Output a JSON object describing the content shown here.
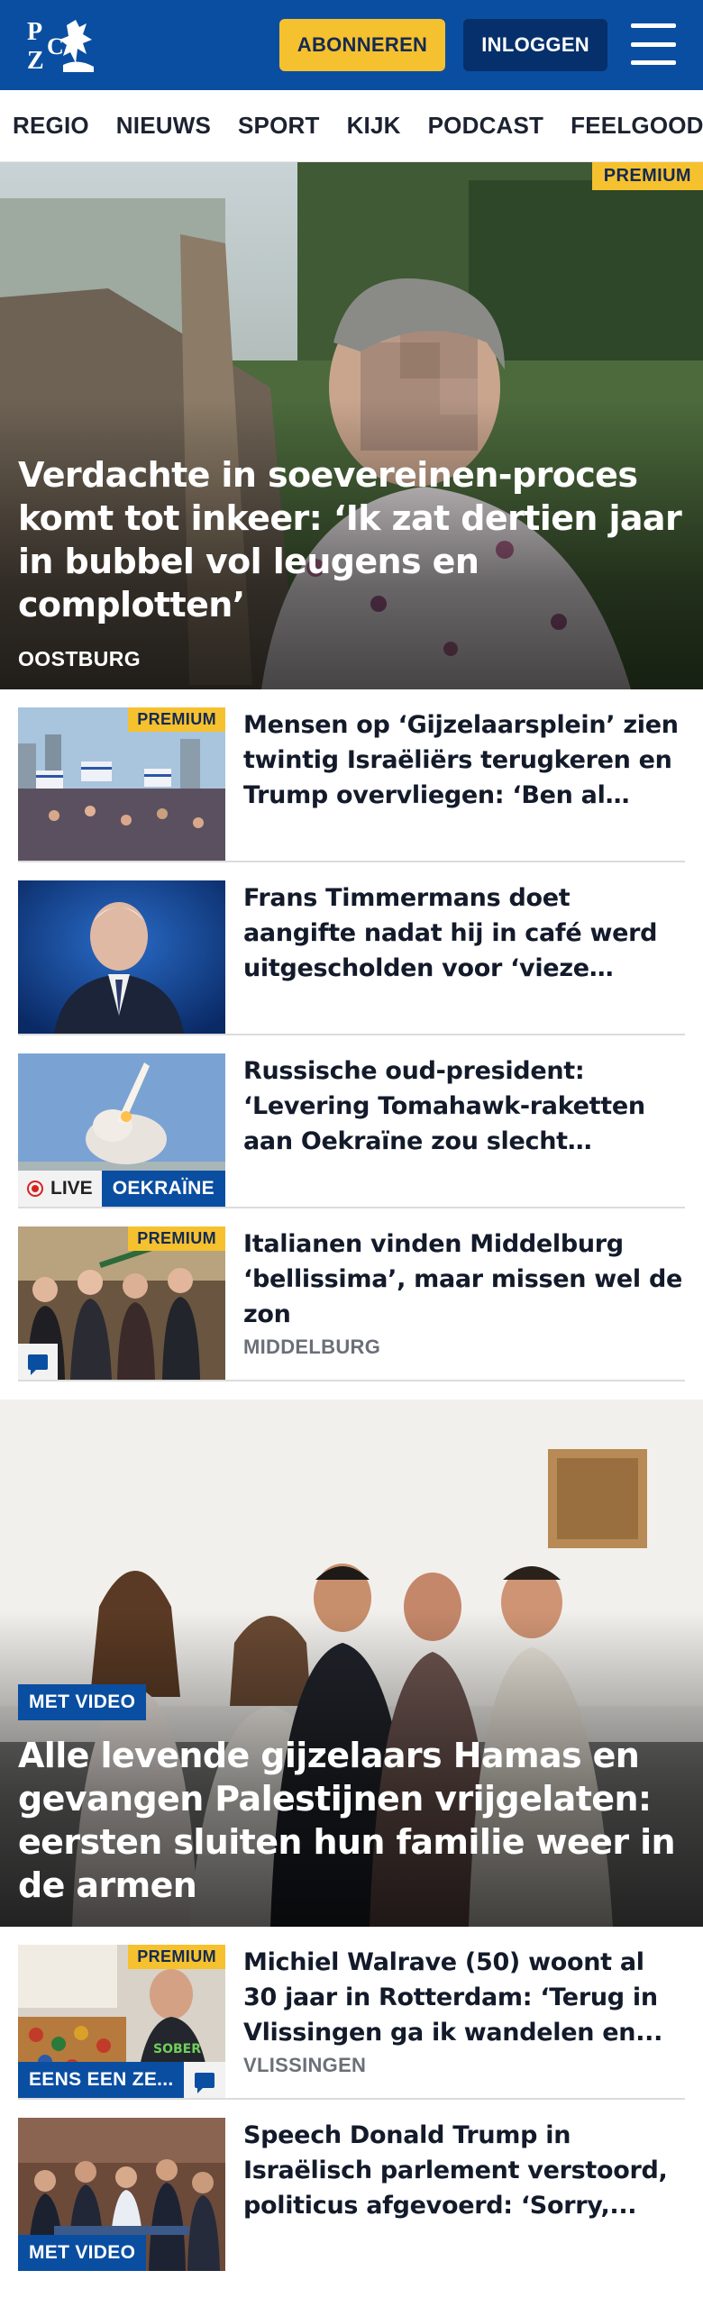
{
  "header": {
    "logo_text": "PZC",
    "subscribe_label": "ABONNEREN",
    "login_label": "INLOGGEN",
    "menu_icon": "hamburger-menu-icon",
    "brand_color": "#0a4ea1",
    "accent_color": "#f6c12e"
  },
  "nav": {
    "items": [
      "REGIO",
      "NIEUWS",
      "SPORT",
      "KIJK",
      "PODCAST",
      "FEELGOOD"
    ]
  },
  "hero": {
    "badge": "PREMIUM",
    "title": "Verdachte in soevereinen-proces komt tot inkeer: ‘Ik zat dertien jaar in bubbel vol leugens en complotten’",
    "location": "OOSTBURG"
  },
  "articles": [
    {
      "badge": "PREMIUM",
      "title": "Mensen op ‘Gijzelaarsplein’ zien twintig Israëliërs terugkeren en Trump overvliegen: ‘Ben al drie..."
    },
    {
      "title": "Frans Timmermans doet aangifte nadat hij in café werd uitgescholden voor ‘vieze kankerhond’ en..."
    },
    {
      "live_label": "LIVE",
      "tag": "OEKRAÏNE",
      "title": "Russische oud-president: ‘Levering Tomahawk-raketten aan Oekraïne zou slecht aflope..."
    },
    {
      "badge": "PREMIUM",
      "title": "Italianen vinden Middelburg ‘bellissima’, maar missen wel de zon",
      "location": "MIDDELBURG",
      "comment_icon": "comment-icon"
    }
  ],
  "hero2": {
    "tag": "MET VIDEO",
    "title": "Alle levende gijzelaars Hamas en gevangen Palestijnen vrijgelaten: eersten sluiten hun familie weer in de armen"
  },
  "articles2": [
    {
      "badge": "PREMIUM",
      "tag": "EENS EEN ZE...",
      "title": "Michiel Walrave (50) woont al 30 jaar in Rotterdam: ‘Terug in Vlissingen ga ik wandelen en...",
      "location": "VLISSINGEN",
      "comment_icon": "comment-icon"
    },
    {
      "tag": "MET VIDEO",
      "title": "Speech Donald Trump in Israëlisch parlement verstoord, politicus afgevoerd: ‘Sorry,..."
    }
  ]
}
